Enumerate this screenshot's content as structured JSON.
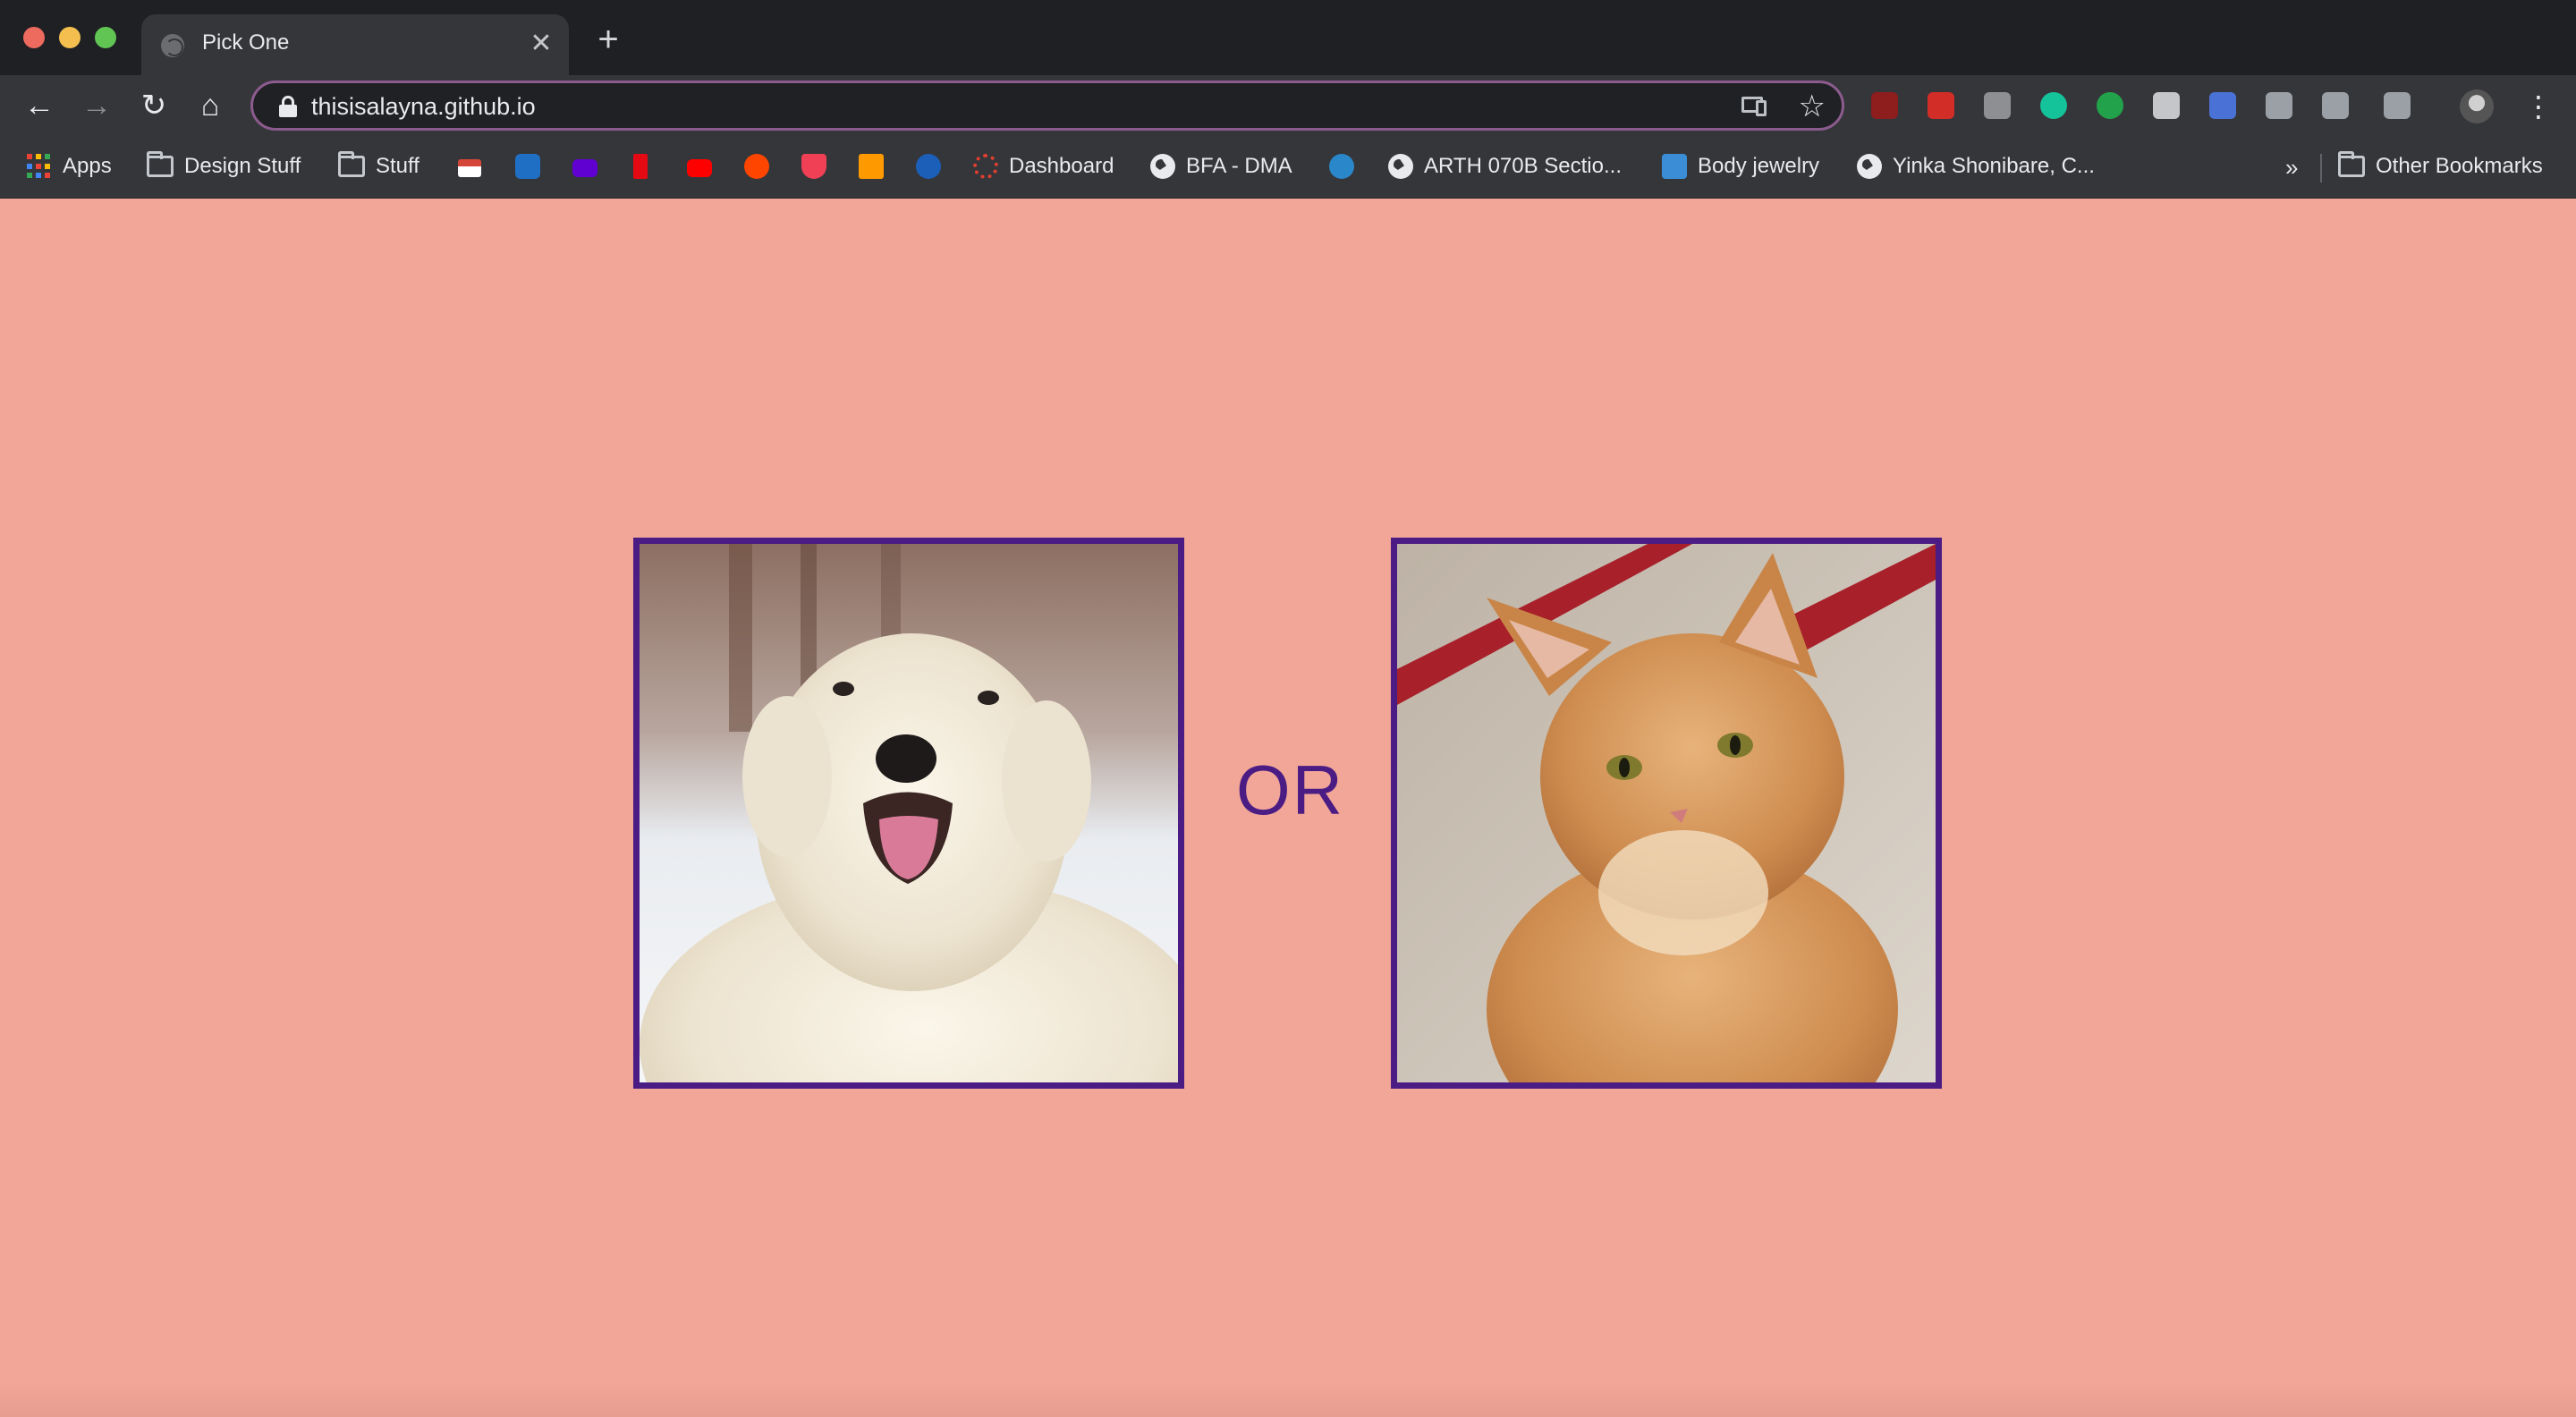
{
  "browser": {
    "tab_title": "Pick One",
    "tab_close": "✕",
    "new_tab": "+",
    "url": "thisisalayna.github.io",
    "nav": {
      "back": "←",
      "forward": "→",
      "reload": "↻",
      "home": "⌂"
    },
    "star": "☆",
    "menu": "⋮",
    "extensions": [
      {
        "name": "ublock-origin-icon",
        "color": "#8e1d1d"
      },
      {
        "name": "lastpass-icon",
        "color": "#d32d27"
      },
      {
        "name": "extension-h-icon",
        "color": "#8d8f93"
      },
      {
        "name": "grammarly-icon",
        "color": "#15c39a"
      },
      {
        "name": "speech-bubble-icon",
        "color": "#22a34b"
      },
      {
        "name": "pocket-icon",
        "color": "#c4c6ca"
      },
      {
        "name": "screenshot-camera-icon",
        "color": "#4a72d6"
      },
      {
        "name": "google-drive-icon",
        "color": "#9aa0a6"
      },
      {
        "name": "css-viewer-icon",
        "color": "#9aa0a6"
      },
      {
        "name": "cast-printer-icon",
        "color": "#9aa0a6"
      }
    ]
  },
  "bookmarks": {
    "apps": "Apps",
    "design_stuff": "Design Stuff",
    "stuff": "Stuff",
    "dashboard": "Dashboard",
    "bfa_dma": "BFA - DMA",
    "arth": "ARTH 070B Sectio...",
    "body_jewelry": "Body jewelry",
    "yinka": "Yinka Shonibare, C...",
    "more": "»",
    "other": "Other Bookmarks",
    "icon_colors": {
      "gmail": "#d44638",
      "outlook": "#1f6fc5",
      "yahoo": "#6001d2",
      "netflix": "#e50914",
      "youtube": "#ff0000",
      "reddit": "#ff4500",
      "pocket": "#ef4056",
      "amazon": "#ff9900",
      "arrow": "#1c5fb8",
      "canvas": "#e13f2f",
      "pearson": "#2a87c9",
      "jewelry": "#3b8ed6"
    }
  },
  "page": {
    "background": "#f2a697",
    "accent": "#4b1c84",
    "separator": "OR",
    "options": [
      {
        "name": "dog-photo",
        "subject": "white fluffy dog in snow"
      },
      {
        "name": "cat-photo",
        "subject": "orange tabby cat"
      }
    ]
  }
}
